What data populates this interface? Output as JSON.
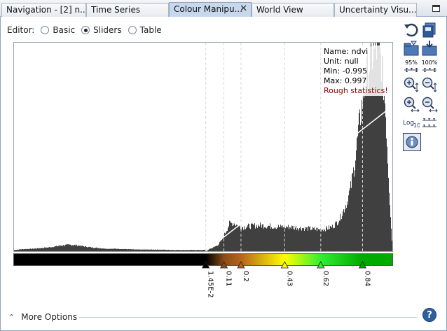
{
  "tabs": [
    {
      "label": "Navigation - [2] n...",
      "active": false
    },
    {
      "label": "Time Series",
      "active": false
    },
    {
      "label": "Colour Manipu...",
      "active": true
    },
    {
      "label": "World View",
      "active": false
    },
    {
      "label": "Uncertainty Visu...",
      "active": false
    }
  ],
  "editor": {
    "label": "Editor:",
    "options": [
      "Basic",
      "Sliders",
      "Table"
    ],
    "selected": "Sliders"
  },
  "info": {
    "name": "Name: ndvi",
    "unit": "Unit: null",
    "min": "Min: -0.995",
    "max": "Max: 0.997",
    "warning": "Rough statistics!",
    "warning_color": "#8b0000"
  },
  "sliders": [
    {
      "label": "1.45E-2",
      "value": 0.0145,
      "color": "#000000"
    },
    {
      "label": "0.11",
      "value": 0.11,
      "color": "#8a4a17"
    },
    {
      "label": "0.2",
      "value": 0.2,
      "color": "#b5651d"
    },
    {
      "label": "0.43",
      "value": 0.43,
      "color": "#ffff00"
    },
    {
      "label": "0.62",
      "value": 0.62,
      "color": "#33ee33"
    },
    {
      "label": "0.84",
      "value": 0.84,
      "color": "#00aa00"
    }
  ],
  "toolbar_icons": [
    "reset-icon",
    "import-icon",
    "export-icon",
    "zoom-95-icon",
    "zoom-100-icon",
    "zoom-in-vertical-icon",
    "zoom-out-vertical-icon",
    "zoom-in-horizontal-icon",
    "zoom-out-horizontal-icon",
    "log10-icon",
    "distribute-sliders-icon",
    "info-toggle-icon"
  ],
  "toolbar_text": {
    "p95": "95%",
    "p100": "100%",
    "log": "Log",
    "log_sub": "10"
  },
  "more_options": "More Options",
  "help": "?",
  "chart_data": {
    "type": "area",
    "x_range": [
      -0.995,
      0.997
    ],
    "color": "#404040",
    "x": [
      -0.995,
      -0.95,
      -0.9,
      -0.85,
      -0.8,
      -0.75,
      -0.7,
      -0.65,
      -0.6,
      -0.55,
      -0.5,
      -0.45,
      -0.4,
      -0.35,
      -0.3,
      -0.25,
      -0.2,
      -0.15,
      -0.1,
      -0.05,
      0.0,
      0.02,
      0.05,
      0.08,
      0.1,
      0.12,
      0.14,
      0.16,
      0.18,
      0.2,
      0.22,
      0.25,
      0.3,
      0.35,
      0.4,
      0.45,
      0.5,
      0.55,
      0.6,
      0.62,
      0.65,
      0.68,
      0.7,
      0.72,
      0.74,
      0.76,
      0.78,
      0.8,
      0.82,
      0.84,
      0.86,
      0.88,
      0.9,
      0.92,
      0.94,
      0.96,
      0.98,
      0.997
    ],
    "y": [
      1.5,
      2.5,
      3,
      4,
      5,
      7,
      8,
      7,
      5,
      4,
      3,
      3,
      2.5,
      2,
      2,
      2,
      1.8,
      1.5,
      1.5,
      1.5,
      1.5,
      2,
      4,
      8,
      14,
      24,
      34,
      35,
      32,
      30,
      30,
      31,
      32,
      31,
      30,
      30,
      29,
      28,
      27,
      27,
      28,
      30,
      34,
      40,
      50,
      62,
      80,
      110,
      150,
      185,
      215,
      235,
      245,
      250,
      235,
      180,
      80,
      5
    ]
  }
}
